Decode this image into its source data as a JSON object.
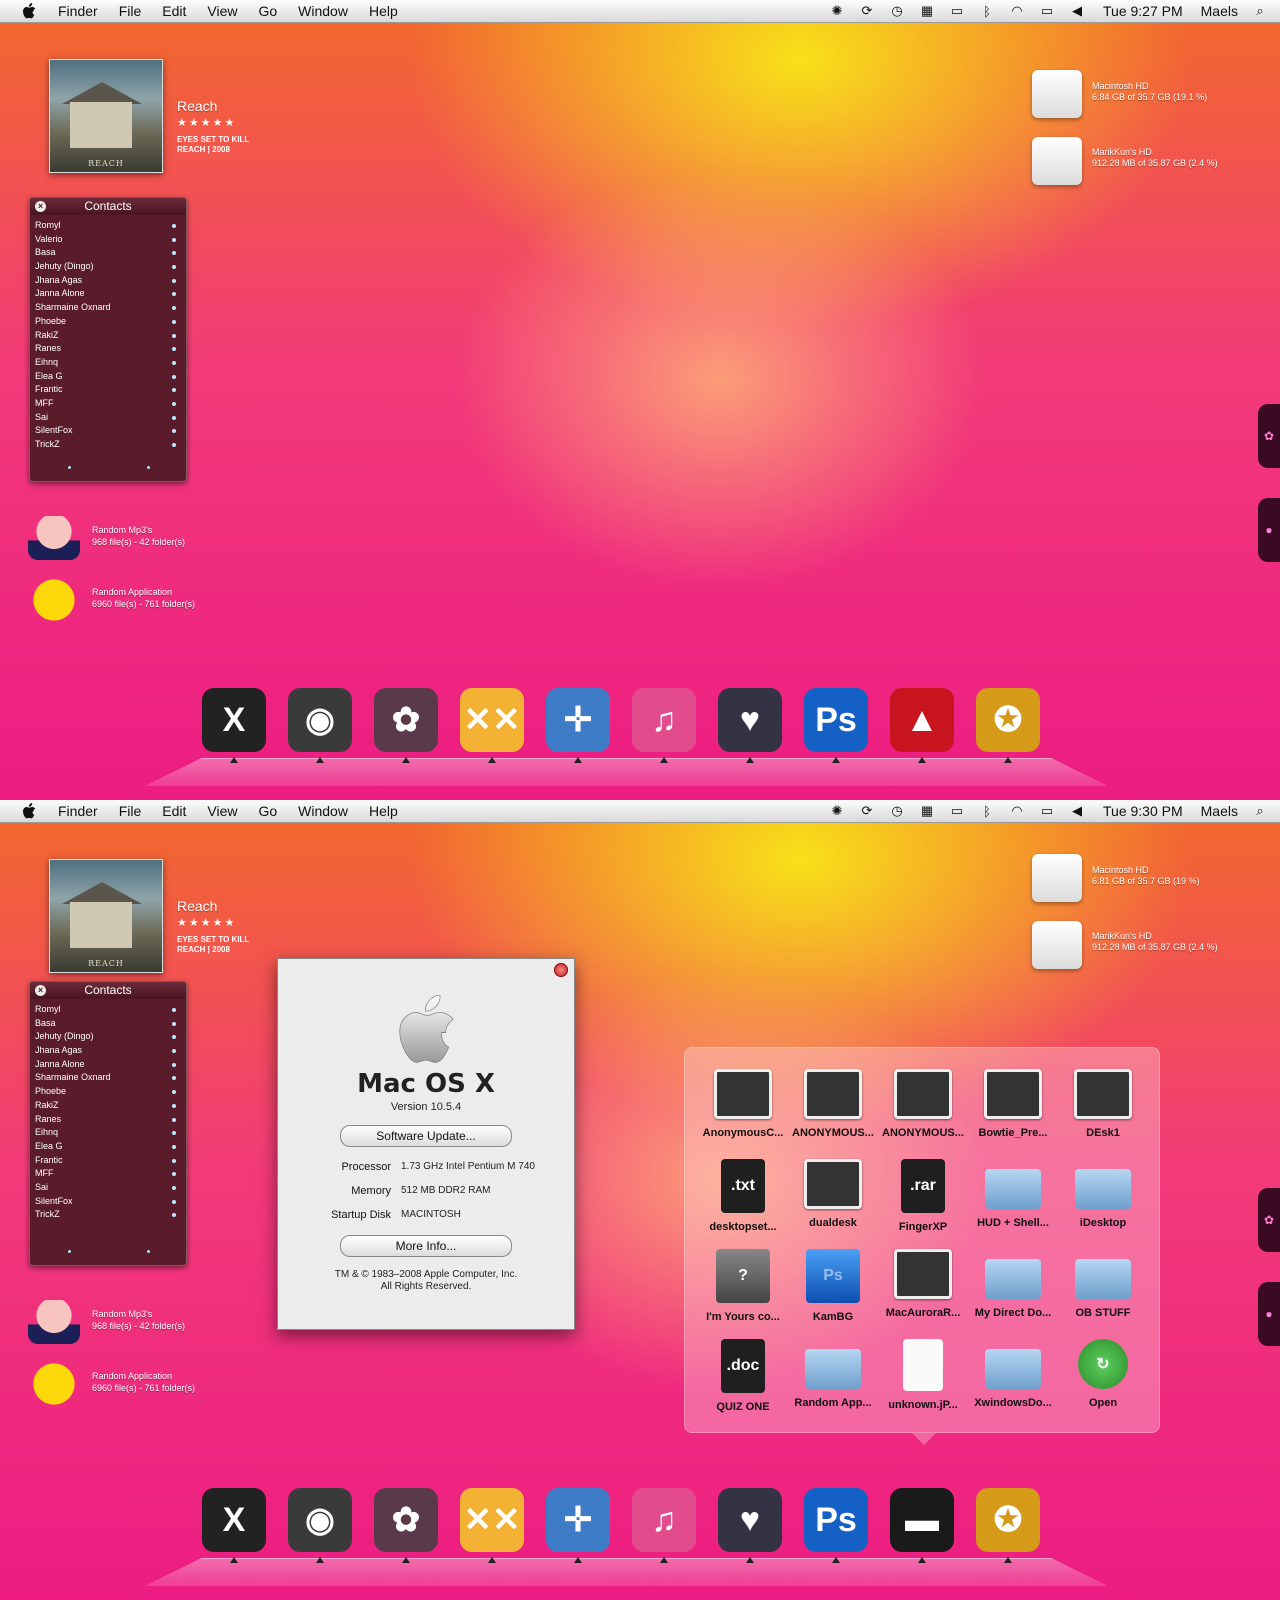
{
  "menubar": {
    "apple_icon": "apple-icon",
    "items": [
      "Finder",
      "File",
      "Edit",
      "View",
      "Go",
      "Window",
      "Help"
    ],
    "status_icons": [
      "fan-icon",
      "sync-icon",
      "time-machine-icon",
      "spaces-icon",
      "display-icon",
      "bluetooth-icon",
      "wifi-icon",
      "battery-icon",
      "volume-icon"
    ],
    "user": "Maels",
    "search_icon": "search-icon"
  },
  "screens": [
    {
      "clock": "Tue 9:27 PM",
      "itunes": {
        "cover_text": "REACH",
        "title": "Reach",
        "stars": "★★★★★",
        "artist": "EYES SET TO KILL",
        "album": "REACH | 2008"
      },
      "contacts": {
        "header": "Contacts",
        "names": [
          "Romyl",
          "Valerio",
          "Basa",
          "Jehuty (Dingo)",
          "Jhana Agas",
          "Janna Alone",
          "Sharmaine Oxnard",
          "Phoebe",
          "RakiZ",
          "Ranes",
          "Eihnq",
          "Elea G",
          "Frantic",
          "MFF",
          "Sai",
          "SilentFox",
          "TrickZ"
        ]
      },
      "random_mp3": {
        "title": "Random Mp3's",
        "detail": "968 file(s) - 42 folder(s)"
      },
      "random_app": {
        "title": "Random Application",
        "detail": "6960 file(s) - 761 folder(s)"
      },
      "drives": [
        {
          "name": "Macintosh HD",
          "usage": "6.84 GB of 35.7 GB (19.1 %)"
        },
        {
          "name": "MarikKun's HD",
          "usage": "912.28 MB of 35.87 GB (2.4 %)"
        }
      ]
    },
    {
      "clock": "Tue 9:30 PM",
      "itunes": {
        "cover_text": "REACH",
        "title": "Reach",
        "stars": "★★★★★",
        "artist": "EYES SET TO KILL",
        "album": "REACH | 2008"
      },
      "contacts": {
        "header": "Contacts",
        "names": [
          "Romyl",
          "Basa",
          "Jehuty (Dingo)",
          "Jhana Agas",
          "Janna Alone",
          "Sharmaine Oxnard",
          "Phoebe",
          "RakiZ",
          "Ranes",
          "Eihnq",
          "Elea G",
          "Frantic",
          "MFF",
          "Sai",
          "SilentFox",
          "TrickZ"
        ]
      },
      "random_mp3": {
        "title": "Random Mp3's",
        "detail": "968 file(s) - 42 folder(s)"
      },
      "random_app": {
        "title": "Random Application",
        "detail": "6960 file(s) - 761 folder(s)"
      },
      "drives": [
        {
          "name": "Macintosh HD",
          "usage": "6.81 GB of 35.7 GB (19 %)"
        },
        {
          "name": "MarikKun's HD",
          "usage": "912.28 MB of 35.87 GB (2.4 %)"
        }
      ],
      "about": {
        "title": "Mac OS X",
        "version": "Version 10.5.4",
        "update_button": "Software Update...",
        "processor_label": "Processor",
        "processor_value": "1.73 GHz Intel Pentium M 740",
        "memory_label": "Memory",
        "memory_value": "512 MB DDR2 RAM",
        "disk_label": "Startup Disk",
        "disk_value": "MACINTOSH",
        "more_button": "More Info...",
        "copyright_1": "TM & © 1983–2008 Apple Computer, Inc.",
        "copyright_2": "All Rights Reserved."
      },
      "stack": [
        {
          "label": "AnonymousC...",
          "kind": "thumb"
        },
        {
          "label": "ANONYMOUS...",
          "kind": "thumb"
        },
        {
          "label": "ANONYMOUS...",
          "kind": "thumb"
        },
        {
          "label": "Bowtie_Pre...",
          "kind": "thumb"
        },
        {
          "label": "DEsk1",
          "kind": "thumb"
        },
        {
          "label": "desktopset...",
          "kind": "file",
          "badge": ".txt"
        },
        {
          "label": "dualdesk",
          "kind": "thumb"
        },
        {
          "label": "FingerXP",
          "kind": "file",
          "badge": ".rar"
        },
        {
          "label": "HUD + Shell...",
          "kind": "folder"
        },
        {
          "label": "iDesktop",
          "kind": "folder"
        },
        {
          "label": "I'm Yours co...",
          "kind": "q",
          "badge": "?"
        },
        {
          "label": "KamBG",
          "kind": "ps",
          "badge": "Ps"
        },
        {
          "label": "MacAuroraR...",
          "kind": "thumb"
        },
        {
          "label": "My Direct Do...",
          "kind": "folder"
        },
        {
          "label": "OB STUFF",
          "kind": "folder"
        },
        {
          "label": "QUIZ ONE",
          "kind": "file",
          "badge": ".doc"
        },
        {
          "label": "Random App...",
          "kind": "folder"
        },
        {
          "label": "unknown.jP...",
          "kind": "doc"
        },
        {
          "label": "XwindowsDo...",
          "kind": "folder"
        },
        {
          "label": "Open",
          "kind": "open",
          "badge": "↻"
        }
      ]
    }
  ],
  "dock_s1": [
    {
      "name": "crossover-icon",
      "glyph": "X",
      "color": "#222222"
    },
    {
      "name": "dashboard-gauge-icon",
      "glyph": "◉",
      "color": "#3a3a3a"
    },
    {
      "name": "iphoto-icon",
      "glyph": "✿",
      "color": "#5a3a4a"
    },
    {
      "name": "cat-adium-icon",
      "glyph": "✕✕",
      "color": "#f3b234"
    },
    {
      "name": "safari-icon",
      "glyph": "✛",
      "color": "#3f7cc8"
    },
    {
      "name": "itunes-donut-icon",
      "glyph": "♫",
      "color": "#e24c8c"
    },
    {
      "name": "coversutra-icon",
      "glyph": "♥",
      "color": "#333344"
    },
    {
      "name": "photoshop-icon",
      "glyph": "Ps",
      "color": "#1560c4"
    },
    {
      "name": "backpack-icon",
      "glyph": "▲",
      "color": "#c8141e"
    },
    {
      "name": "popcorn-icon",
      "glyph": "✪",
      "color": "#d49a18"
    }
  ],
  "dock_s2": [
    {
      "name": "crossover-icon",
      "glyph": "X",
      "color": "#222222"
    },
    {
      "name": "dashboard-gauge-icon",
      "glyph": "◉",
      "color": "#3a3a3a"
    },
    {
      "name": "iphoto-icon",
      "glyph": "✿",
      "color": "#5a3a4a"
    },
    {
      "name": "cat-adium-icon",
      "glyph": "✕✕",
      "color": "#f3b234"
    },
    {
      "name": "safari-icon",
      "glyph": "✛",
      "color": "#3f7cc8"
    },
    {
      "name": "itunes-donut-icon",
      "glyph": "♫",
      "color": "#e24c8c"
    },
    {
      "name": "coversutra-icon",
      "glyph": "♥",
      "color": "#333344"
    },
    {
      "name": "photoshop-icon",
      "glyph": "Ps",
      "color": "#1560c4"
    },
    {
      "name": "stack-tray-icon",
      "glyph": "▬",
      "color": "#1a1a1a"
    },
    {
      "name": "popcorn-icon",
      "glyph": "✪",
      "color": "#d49a18"
    }
  ],
  "colors": {
    "wallpaper_top": "#f8e818",
    "wallpaper_bottom": "#ec1c83",
    "contacts_bg": "#5a1c2a"
  }
}
